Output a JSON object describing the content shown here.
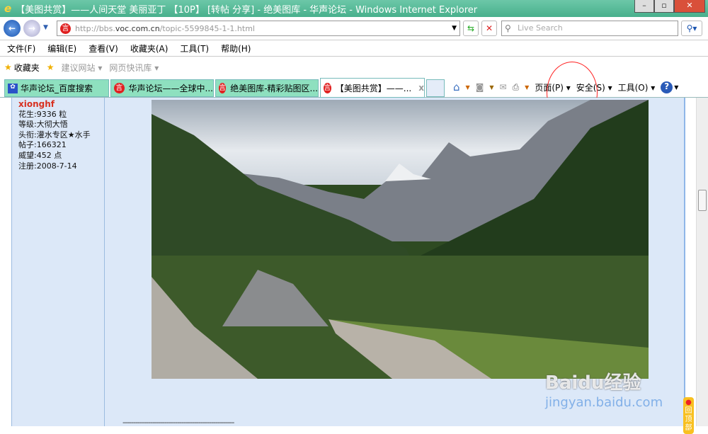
{
  "window": {
    "title": "【美图共赏】——人间天堂 美丽亚丁 【10P】 [转帖 分享] - 绝美图库 - 华声论坛 - Windows Internet Explorer",
    "min": "–",
    "max": "▫",
    "close": "✕"
  },
  "address": {
    "prefix": "http://bbs.",
    "domain": "voc.com.cn",
    "path": "/topic-5599845-1-1.html",
    "icon": "voc-icon"
  },
  "search": {
    "placeholder": "Live Search"
  },
  "menu": [
    "文件(F)",
    "编辑(E)",
    "查看(V)",
    "收藏夹(A)",
    "工具(T)",
    "帮助(H)"
  ],
  "favorites": {
    "label": "收藏夹",
    "items": [
      "建议网站 ▾",
      "网页快讯库 ▾"
    ]
  },
  "tabs": [
    "华声论坛_百度搜索",
    "华声论坛——全球中...",
    "绝美图库-精彩贴图区...",
    "【美图共赏】——..."
  ],
  "tab_close": "x",
  "toolbar": {
    "page": "页面(P) ▾",
    "safety": "安全(S) ▾",
    "tools": "工具(O) ▾"
  },
  "user": {
    "name": "xionghf",
    "lines": [
      "花生:9336 粒",
      "等级:大彻大悟",
      "头衔:灌水专区★水手",
      "帖子:166321",
      "威望:452 点",
      "注册:2008-7-14"
    ]
  },
  "back_to_top": "回顶部",
  "separator": "-----------------------------------------------------",
  "watermark": {
    "brand": "Baidu经验",
    "url": "jingyan.baidu.com"
  }
}
